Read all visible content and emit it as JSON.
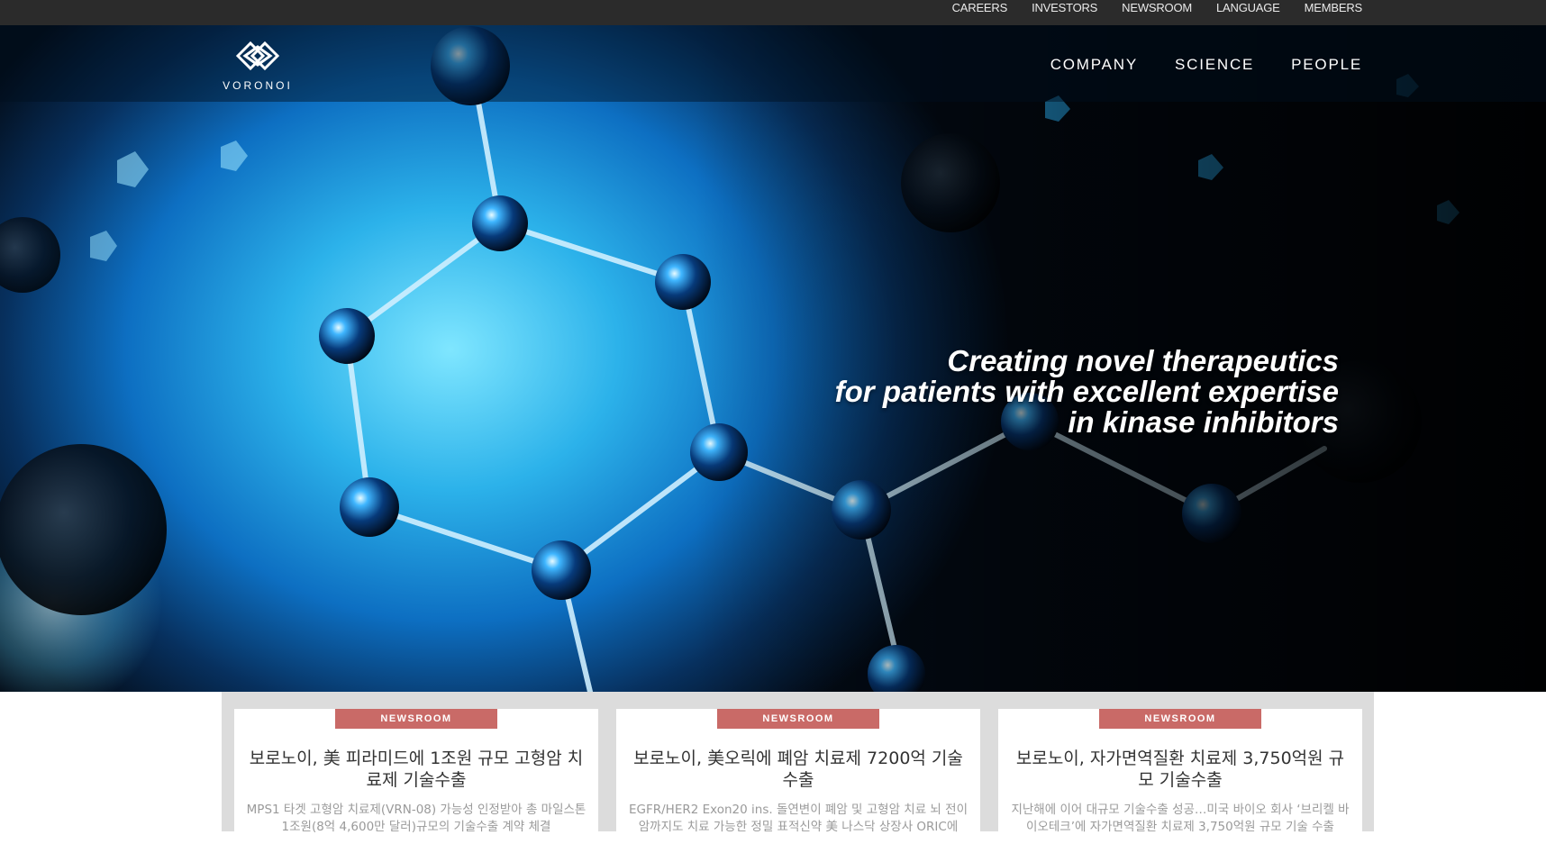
{
  "top_menu": [
    "CAREERS",
    "INVESTORS",
    "NEWSROOM",
    "LANGUAGE",
    "MEMBERS"
  ],
  "brand": {
    "name": "VORONOI"
  },
  "main_nav": [
    "COMPANY",
    "SCIENCE",
    "PEOPLE"
  ],
  "hero": {
    "line1": "Creating novel therapeutics",
    "line2": "for patients with excellent expertise",
    "line3": "in kinase inhibitors"
  },
  "news": [
    {
      "tag": "NEWSROOM",
      "title": "보로노이, 美 피라미드에 1조원 규모 고형암 치료제 기술수출",
      "desc": "MPS1 타겟 고형암 치료제(VRN-08) 가능성 인정받아 총 마일스톤 1조원(8억 4,600만 달러)규모의 기술수출 계약 체결"
    },
    {
      "tag": "NEWSROOM",
      "title": "보로노이, 美오릭에 폐암 치료제 7200억 기술수출",
      "desc": "EGFR/HER2 Exon20 ins. 돌연변이 폐암 및 고형암 치료 뇌 전이암까지도 치료 가능한 정밀 표적신약 美 나스닥 상장사 ORIC에"
    },
    {
      "tag": "NEWSROOM",
      "title": "보로노이, 자가면역질환 치료제 3,750억원 규모 기술수출",
      "desc": "지난해에 이어 대규모 기술수출 성공…미국 바이오 회사 ‘브리켈 바이오테크’에 자가면역질환 치료제 3,750억원 규모 기술 수출"
    }
  ],
  "colors": {
    "topbar": "#2b2b2b",
    "tag": "#c96a67",
    "news_bg": "#dcdcdc"
  }
}
